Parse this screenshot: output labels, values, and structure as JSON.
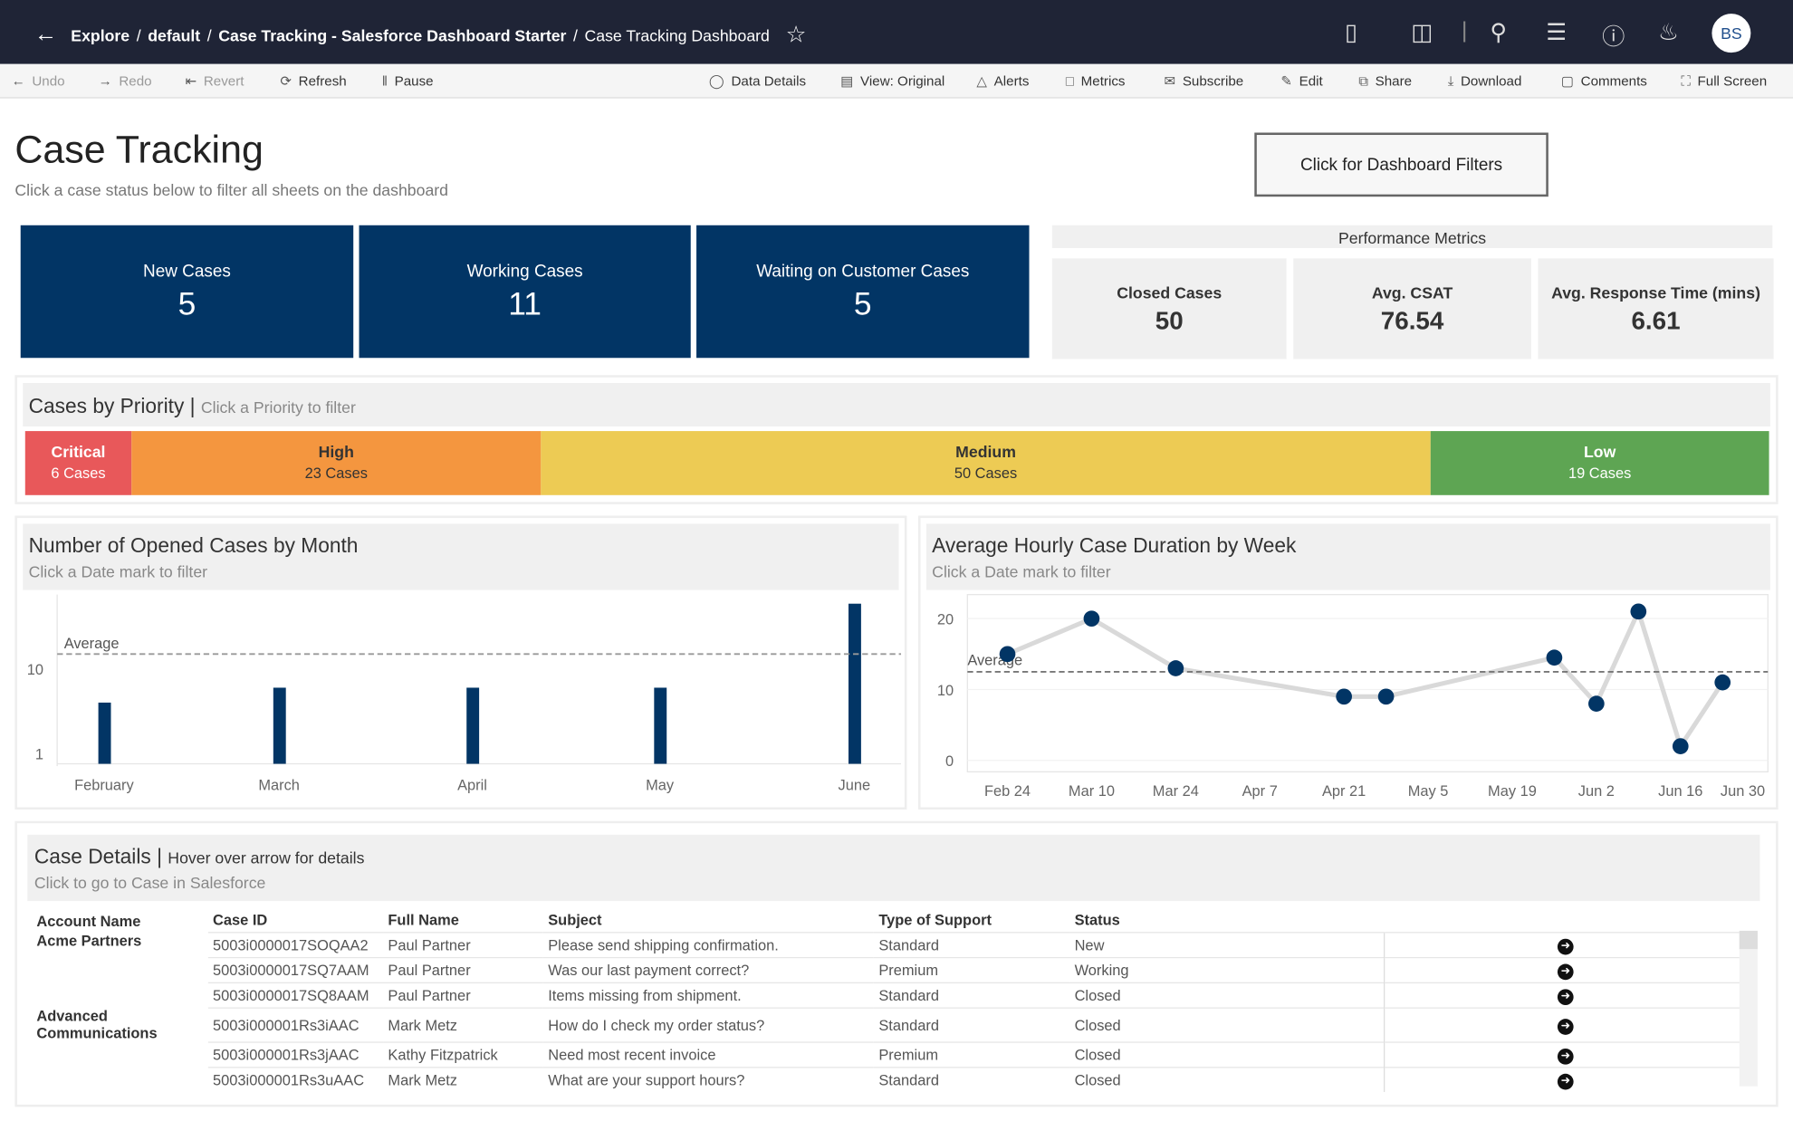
{
  "breadcrumb": {
    "items": [
      "Explore",
      "default",
      "Case Tracking - Salesforce Dashboard Starter",
      "Case Tracking Dashboard"
    ]
  },
  "user": {
    "initials": "BS"
  },
  "toolbar": {
    "undo": "Undo",
    "redo": "Redo",
    "revert": "Revert",
    "refresh": "Refresh",
    "pause": "Pause",
    "data_details": "Data Details",
    "view": "View: Original",
    "alerts": "Alerts",
    "metrics": "Metrics",
    "subscribe": "Subscribe",
    "edit": "Edit",
    "share": "Share",
    "download": "Download",
    "comments": "Comments",
    "full_screen": "Full Screen"
  },
  "header": {
    "title": "Case Tracking",
    "subtitle": "Click a case status below to filter all sheets on the dashboard",
    "filter_button": "Click for Dashboard Filters"
  },
  "kpis": [
    {
      "label": "New Cases",
      "value": "5"
    },
    {
      "label": "Working Cases",
      "value": "11"
    },
    {
      "label": "Waiting on Customer Cases",
      "value": "5"
    }
  ],
  "performance": {
    "title": "Performance Metrics",
    "items": [
      {
        "label": "Closed Cases",
        "value": "50"
      },
      {
        "label": "Avg. CSAT",
        "value": "76.54"
      },
      {
        "label": "Avg. Response Time (mins)",
        "value": "6.61"
      }
    ]
  },
  "priority": {
    "title": "Cases by Priority",
    "hint": "Click a Priority to filter",
    "segments": [
      {
        "name": "Critical",
        "cases": "6 Cases",
        "count": 6,
        "color": "#e8585a",
        "text": "#fff"
      },
      {
        "name": "High",
        "cases": "23 Cases",
        "count": 23,
        "color": "#f4963f",
        "text": "#333"
      },
      {
        "name": "Medium",
        "cases": "50 Cases",
        "count": 50,
        "color": "#edcb54",
        "text": "#333"
      },
      {
        "name": "Low",
        "cases": "19 Cases",
        "count": 19,
        "color": "#5ea553",
        "text": "#fff"
      }
    ]
  },
  "chart_data": [
    {
      "type": "bar",
      "title": "Number of Opened Cases by Month",
      "subtitle": "Click a Date mark to filter",
      "categories": [
        "February",
        "March",
        "April",
        "May",
        "June"
      ],
      "values": [
        4,
        6,
        6,
        6,
        59
      ],
      "yscale": "log",
      "yticks": [
        "1",
        "10"
      ],
      "average": 15,
      "average_label": "Average",
      "color": "#023565"
    },
    {
      "type": "line",
      "title": "Average Hourly Case Duration by Week",
      "subtitle": "Click a Date mark to filter",
      "x": [
        "2019-02-24",
        "2019-03-10",
        "2019-03-24",
        "2019-04-21",
        "2019-04-28",
        "2019-05-26",
        "2019-06-02",
        "2019-06-09",
        "2019-06-16",
        "2019-06-23"
      ],
      "values": [
        15,
        20,
        13,
        9,
        9,
        14.5,
        8,
        21,
        2,
        11
      ],
      "xticks": [
        "Feb 24",
        "Mar 10",
        "Mar 24",
        "Apr 7",
        "Apr 21",
        "May 5",
        "May 19",
        "Jun 2",
        "Jun 16",
        "Jun 30"
      ],
      "yticks": [
        "0",
        "10",
        "20"
      ],
      "ylim": [
        0,
        22
      ],
      "average": 12.5,
      "average_label": "Average",
      "color": "#023565"
    }
  ],
  "details": {
    "title": "Case Details",
    "hint": "Hover over arrow for details",
    "sub": "Click to go to Case in Salesforce",
    "columns": [
      "Account Name",
      "Case ID",
      "Full Name",
      "Subject",
      "Type of Support",
      "Status"
    ],
    "rows": [
      {
        "account": "Acme Partners",
        "id": "5003i0000017SOQAA2",
        "name": "Paul Partner",
        "subject": "Please send shipping confirmation.",
        "type": "Standard",
        "status": "New"
      },
      {
        "account": "",
        "id": "5003i0000017SQ7AAM",
        "name": "Paul Partner",
        "subject": "Was our last payment correct?",
        "type": "Premium",
        "status": "Working"
      },
      {
        "account": "",
        "id": "5003i0000017SQ8AAM",
        "name": "Paul Partner",
        "subject": "Items missing from shipment.",
        "type": "Standard",
        "status": "Closed"
      },
      {
        "account": "Advanced Communications",
        "id": "5003i000001Rs3iAAC",
        "name": "Mark Metz",
        "subject": "How do I check my order status?",
        "type": "Standard",
        "status": "Closed"
      },
      {
        "account": "",
        "id": "5003i000001Rs3jAAC",
        "name": "Kathy Fitzpatrick",
        "subject": "Need most recent invoice",
        "type": "Premium",
        "status": "Closed"
      },
      {
        "account": "",
        "id": "5003i000001Rs3uAAC",
        "name": "Mark Metz",
        "subject": "What are your support hours?",
        "type": "Standard",
        "status": "Closed"
      }
    ]
  }
}
